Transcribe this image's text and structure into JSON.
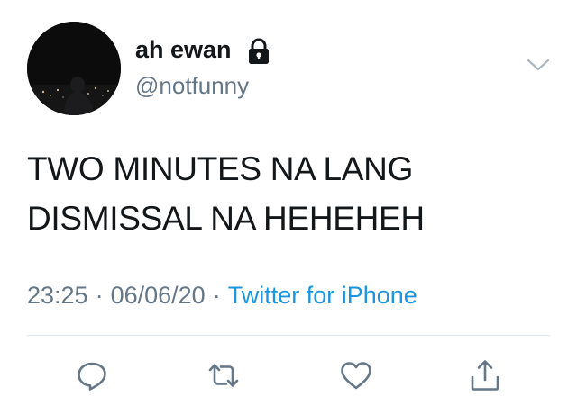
{
  "user": {
    "display_name": "ah ewan",
    "handle": "@notfunny",
    "protected_icon": "lock-icon",
    "avatar": "night-city-photo"
  },
  "tweet": {
    "lines": [
      "TWO MINUTES NA LANG",
      "DISMISSAL NA HEHEHEH"
    ],
    "time": "23:25",
    "date": "06/06/20",
    "separator": "·",
    "source": "Twitter for iPhone"
  },
  "menu": {
    "icon": "chevron-down-icon"
  },
  "actions": [
    {
      "name": "reply",
      "icon": "reply-icon"
    },
    {
      "name": "retweet",
      "icon": "retweet-icon"
    },
    {
      "name": "like",
      "icon": "heart-icon"
    },
    {
      "name": "share",
      "icon": "share-icon"
    }
  ],
  "colors": {
    "text": "#14171a",
    "secondary": "#657786",
    "link": "#1b95e0",
    "divider": "#e1e8ed"
  }
}
